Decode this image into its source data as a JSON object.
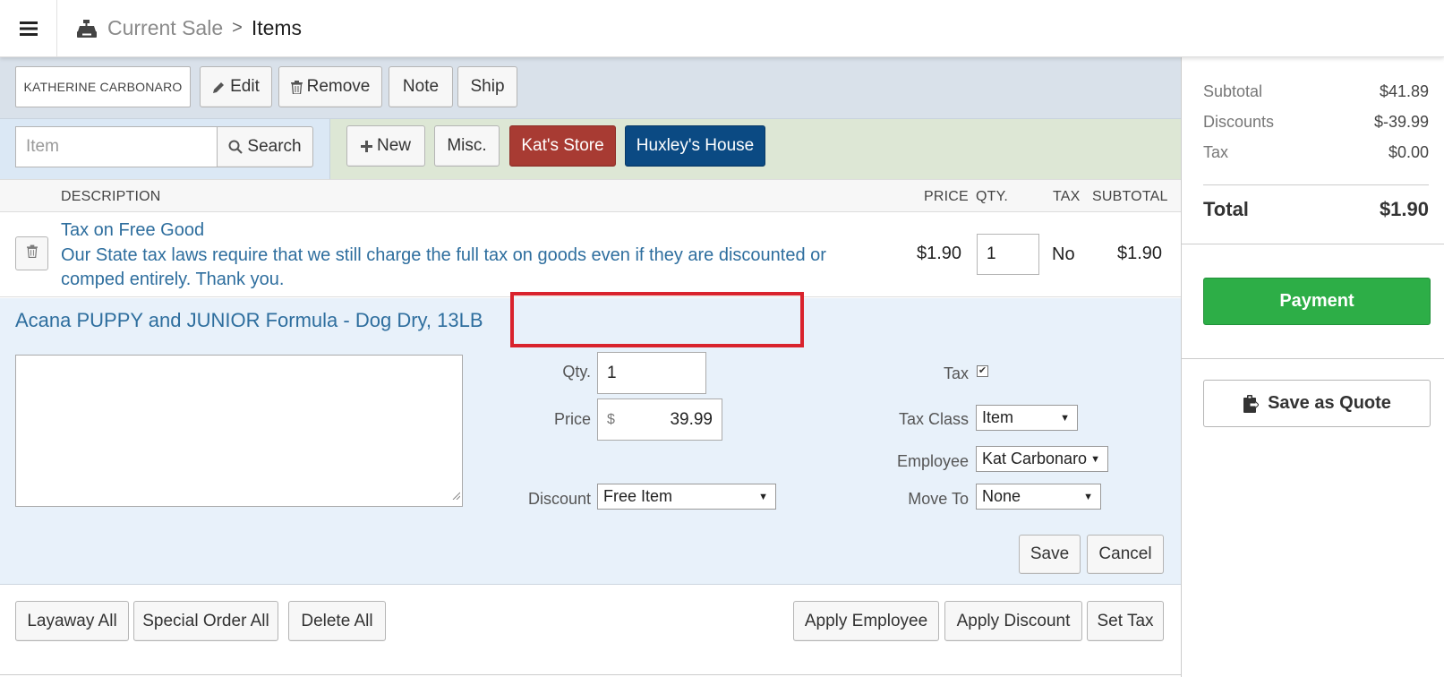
{
  "header": {
    "menu_icon": "hamburger-menu-icon",
    "register_icon": "cash-register-icon",
    "crumb_current_sale": "Current Sale",
    "crumb_separator": ">",
    "crumb_items": "Items"
  },
  "customer": {
    "name": "KATHERINE CARBONARO",
    "edit_label": "Edit",
    "remove_label": "Remove",
    "note_label": "Note",
    "ship_label": "Ship"
  },
  "search": {
    "placeholder": "Item",
    "search_label": "Search",
    "new_label": "New",
    "misc_label": "Misc.",
    "kats_store_label": "Kat's Store",
    "huxleys_house_label": "Huxley's House"
  },
  "colors": {
    "kats_store": "#a83b33",
    "huxleys_house": "#0b4a83",
    "payment": "#2dae47",
    "highlight": "#d9232d",
    "link": "#2e6e9e"
  },
  "table": {
    "headers": {
      "description": "DESCRIPTION",
      "price": "PRICE",
      "qty": "QTY.",
      "tax": "TAX",
      "subtotal": "SUBTOTAL"
    },
    "rows": [
      {
        "title": "Tax on Free Good",
        "description": "Our State tax laws require that we still charge the full tax on goods even if they are discounted or comped entirely. Thank you.",
        "price": "$1.90",
        "qty": "1",
        "tax": "No",
        "subtotal": "$1.90"
      }
    ]
  },
  "edit_item": {
    "title": "Acana PUPPY and JUNIOR Formula - Dog Dry, 13LB",
    "note": "",
    "qty_label": "Qty.",
    "qty_value": "1",
    "price_label": "Price",
    "currency_symbol": "$",
    "price_value": "39.99",
    "discount_label": "Discount",
    "discount_value": "Free Item",
    "tax_label": "Tax",
    "tax_checked": true,
    "tax_class_label": "Tax Class",
    "tax_class_value": "Item",
    "employee_label": "Employee",
    "employee_value": "Kat Carbonaro",
    "move_to_label": "Move To",
    "move_to_value": "None",
    "save_label": "Save",
    "cancel_label": "Cancel"
  },
  "bottom_actions": {
    "layaway_all": "Layaway All",
    "special_order_all": "Special Order All",
    "delete_all": "Delete All",
    "apply_employee": "Apply Employee",
    "apply_discount": "Apply Discount",
    "set_tax": "Set Tax"
  },
  "summary": {
    "subtotal_label": "Subtotal",
    "subtotal_value": "$41.89",
    "discounts_label": "Discounts",
    "discounts_value": "$-39.99",
    "tax_label": "Tax",
    "tax_value": "$0.00",
    "total_label": "Total",
    "total_value": "$1.90",
    "payment_label": "Payment",
    "save_quote_label": "Save as Quote"
  }
}
